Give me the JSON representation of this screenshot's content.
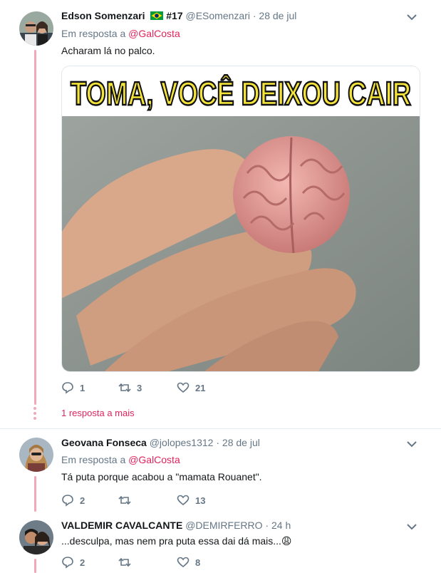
{
  "tweets": [
    {
      "name": "Edson Somenzari",
      "badge": "#17",
      "handle": "@ESomenzari",
      "date": "28 de jul",
      "reply_prefix": "Em resposta a",
      "reply_to": "@GalCosta",
      "text": "Acharam lá no palco.",
      "replies": "1",
      "retweets": "3",
      "likes": "21"
    },
    {
      "name": "Geovana Fonseca",
      "handle": "@jolopes1312",
      "date": "28 de jul",
      "reply_prefix": "Em resposta a",
      "reply_to": "@GalCosta",
      "text": "Tá puta porque acabou a \"mamata Rouanet\".",
      "replies": "2",
      "retweets": "",
      "likes": "13"
    },
    {
      "name": "VALDEMIR CAVALCANTE",
      "handle": "@DEMIRFERRO",
      "date": "24 h",
      "text": "...desculpa, mas nem pra puta essa dai dá mais...😩",
      "replies": "2",
      "retweets": "",
      "likes": "8"
    }
  ],
  "meme_caption": "TOMA, VOCÊ DEIXOU CAIR",
  "more_replies_label": "1 resposta a mais",
  "dot_separator": "·",
  "colors": {
    "accent": "#e0245e",
    "thread": "#f4a7b9",
    "muted": "#657786",
    "text": "#14171a"
  }
}
